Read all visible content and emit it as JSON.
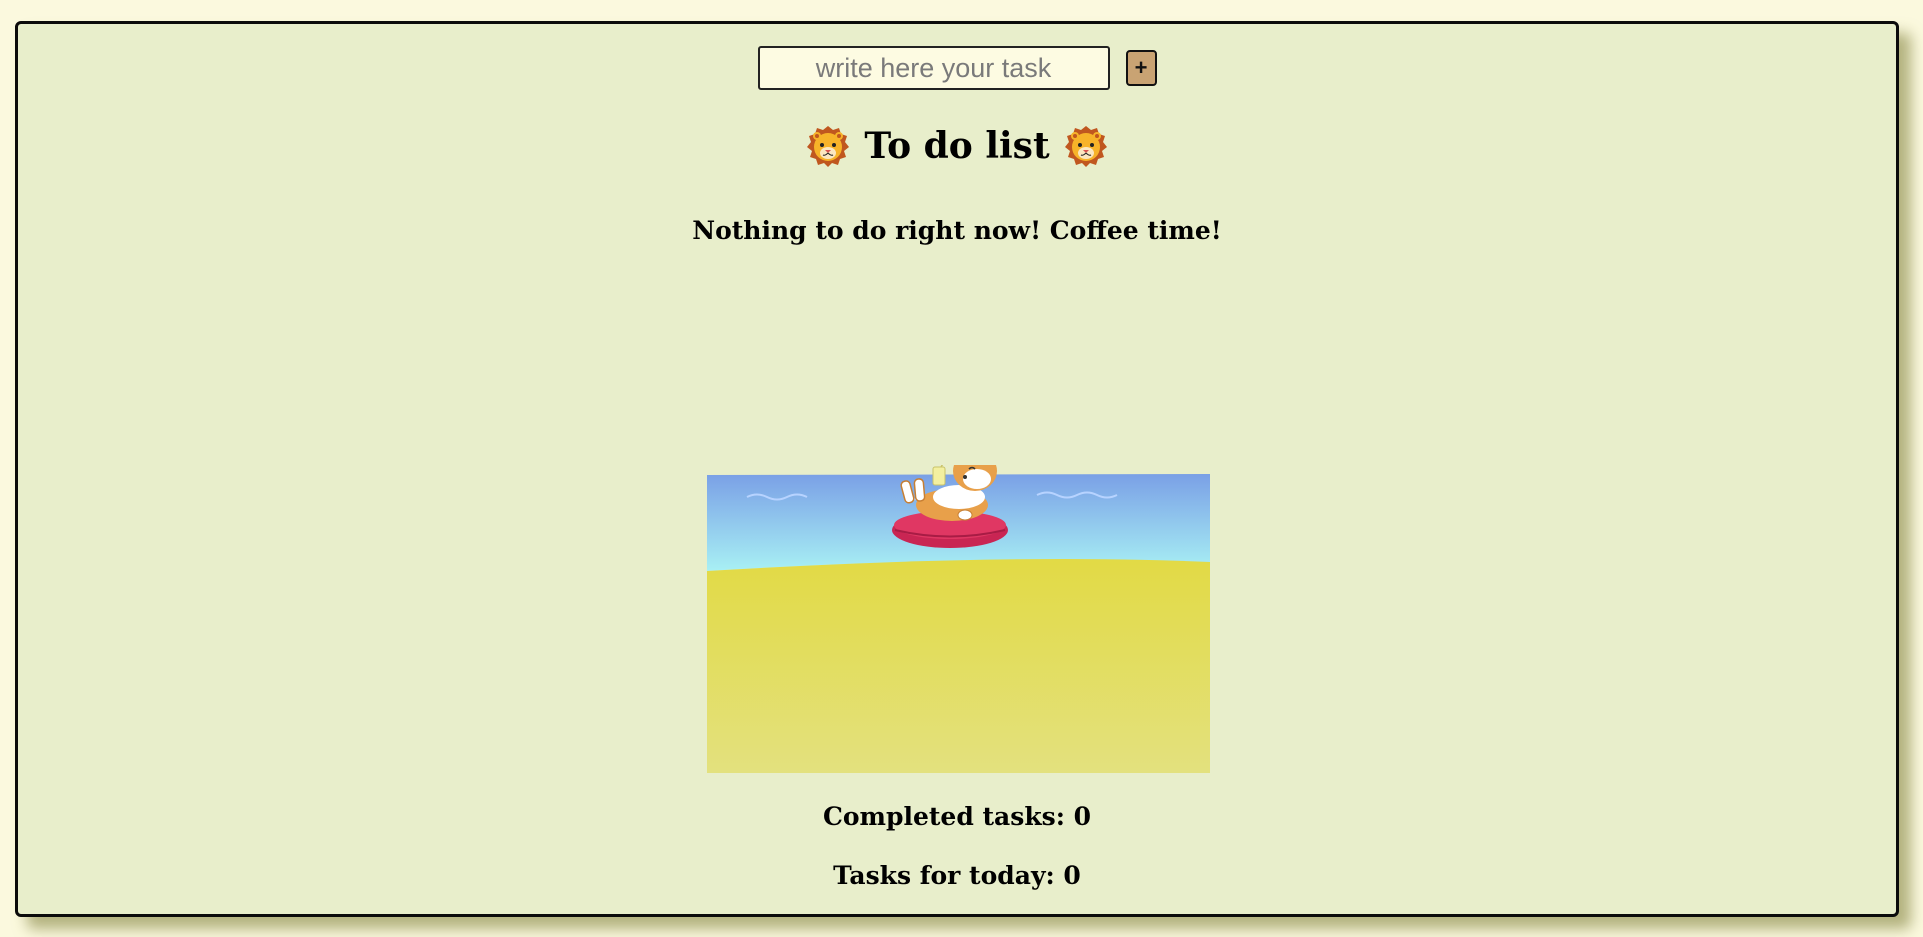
{
  "new_task": {
    "placeholder": "write here your task",
    "value": "",
    "add_label": "+"
  },
  "header": {
    "title": "To do list",
    "icon": "lion-face-icon"
  },
  "empty_state": {
    "message": "Nothing to do right now! Coffee time!",
    "illustration": "corgi-floating-beach-illustration"
  },
  "stats": {
    "completed_label": "Completed tasks: 0",
    "today_label": "Tasks for today: 0"
  },
  "colors": {
    "page_background": "#fbf9de",
    "card_background": "#e8eecb",
    "add_button": "#c9a373",
    "water": "#7aa7e6",
    "sand": "#e2db52",
    "float_ring": "#d63b5e"
  }
}
